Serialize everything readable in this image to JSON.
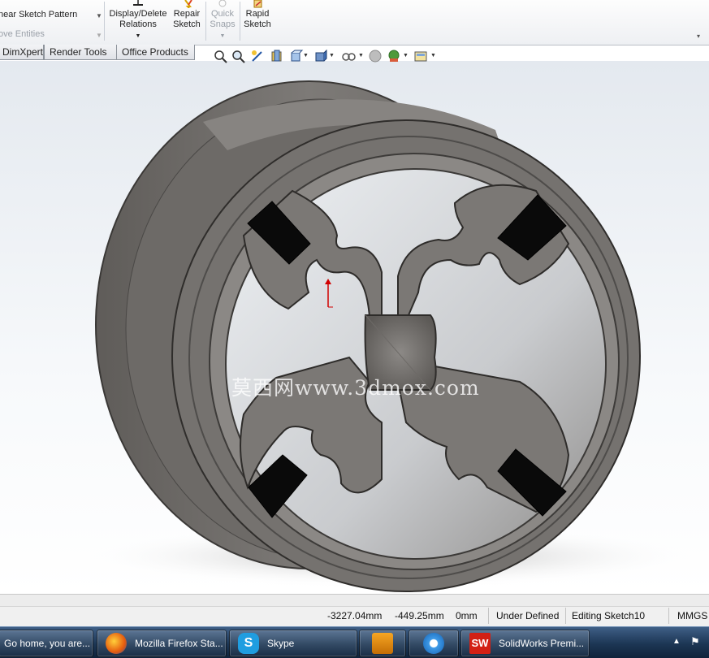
{
  "ribbon": {
    "linear_sketch_pattern": "near Sketch Pattern",
    "move_entities": "ove Entities",
    "display_delete": "Display/Delete",
    "relations": "Relations",
    "repair": "Repair",
    "sketch1": "Sketch",
    "quick": "Quick",
    "snaps": "Snaps",
    "rapid": "Rapid",
    "sketch2": "Sketch"
  },
  "tabs": [
    "DimXpert",
    "Render Tools",
    "Office Products"
  ],
  "hud_icons": [
    "zoom-to-fit-icon",
    "zoom-to-area-icon",
    "previous-view-icon",
    "section-view-icon",
    "view-orientation-icon",
    "display-style-icon",
    "hide-show-items-icon",
    "edit-appearance-icon",
    "apply-scene-icon",
    "view-settings-icon"
  ],
  "viewport": {
    "watermark": "莫西网www.3dmox.com"
  },
  "status": {
    "x": "-3227.04mm",
    "y": "-449.25mm",
    "z": "0mm",
    "state": "Under Defined",
    "editing": "Editing Sketch10",
    "units": "MMGS"
  },
  "taskbar": {
    "items": [
      {
        "label": "Go home, you are..."
      },
      {
        "label": "Mozilla Firefox Sta..."
      },
      {
        "label": "Skype"
      },
      {
        "label": ""
      },
      {
        "label": ""
      },
      {
        "label": "SolidWorks Premi..."
      }
    ]
  },
  "colors": {
    "ribbon_bg": "#eef0f3",
    "taskbar": "#1c3654",
    "model_gray": "#6e6b68",
    "rim_light": "#8a8784"
  }
}
